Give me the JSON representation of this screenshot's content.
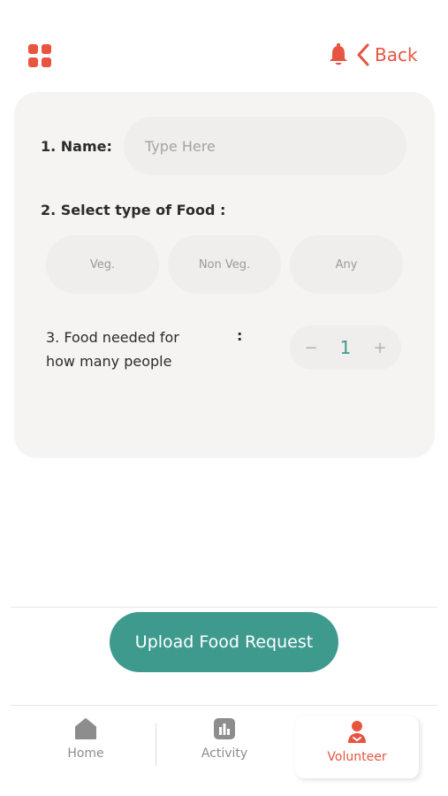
{
  "header": {
    "menu_icon": "grid-icon",
    "bell_icon": "bell-icon",
    "back_label": "Back",
    "accent_color": "#e8543f"
  },
  "form": {
    "name_label": "1.  Name:",
    "name_placeholder": "Type Here",
    "name_value": "",
    "food_type_label": "2. Select type of Food :",
    "food_options": [
      "Veg.",
      "Non Veg.",
      "Any"
    ],
    "people_label_line1": "3. Food needed for",
    "people_label_line2": "how many people",
    "people_colon": ":",
    "stepper_minus": "−",
    "stepper_value": "1",
    "stepper_plus": "+"
  },
  "actions": {
    "upload_label": "Upload Food Request",
    "upload_color": "#3f9a8e"
  },
  "nav": {
    "items": [
      {
        "label": "Home",
        "icon": "home-icon"
      },
      {
        "label": "Activity",
        "icon": "activity-icon"
      },
      {
        "label": "Volunteer",
        "icon": "volunteer-icon"
      }
    ],
    "active": "Volunteer"
  }
}
